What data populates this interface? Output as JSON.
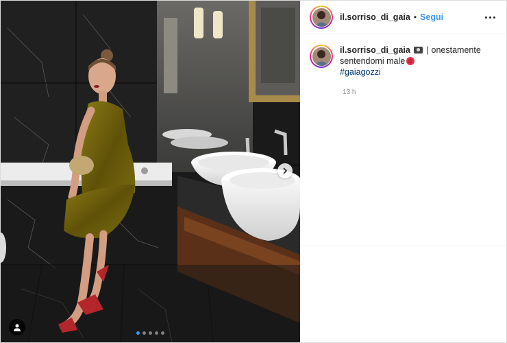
{
  "post": {
    "username": "il.sorriso_di_gaia",
    "separator": "•",
    "follow_label": "Segui",
    "carousel": {
      "total": 5,
      "active": 0
    }
  },
  "caption": {
    "username": "il.sorriso_di_gaia",
    "text": "| onestamente sentendomi male",
    "hashtag": "#gaiagozzi",
    "time": "13 h"
  },
  "icons": {
    "more": "more-options-icon",
    "next": "chevron-right-icon",
    "tag": "user-tag-icon",
    "camera": "camera-emoji-icon",
    "angry": "angry-face-emoji-icon"
  },
  "colors": {
    "accent": "#3897f0",
    "text": "#262626",
    "muted": "#8e8e8e",
    "hashtag": "#00376b"
  }
}
